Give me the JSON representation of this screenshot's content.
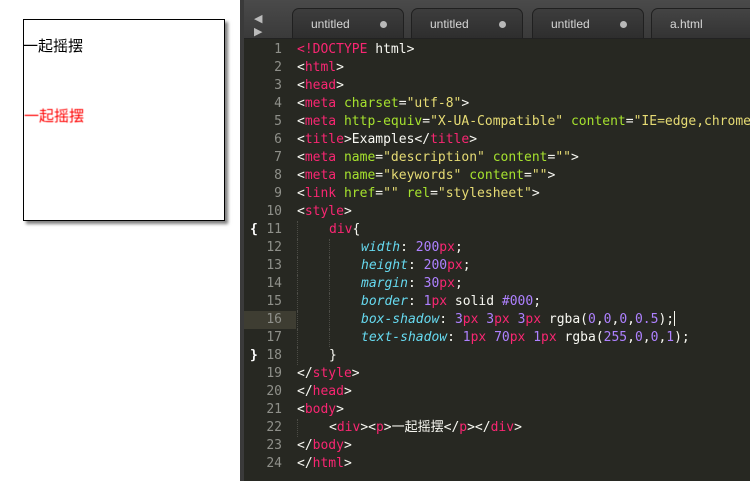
{
  "preview": {
    "text": "一起摇摆"
  },
  "editor": {
    "nav_arrows": "◀ ▶",
    "tabs": [
      {
        "label": "untitled"
      },
      {
        "label": "untitled"
      },
      {
        "label": "untitled"
      },
      {
        "label": "a.html"
      }
    ],
    "lines": [
      {
        "n": "1",
        "tokens": [
          [
            "t-tag",
            "<!DOCTYPE"
          ],
          [
            "t-plain",
            " html>"
          ]
        ]
      },
      {
        "n": "2",
        "tokens": [
          [
            "t-plain",
            "<"
          ],
          [
            "t-tag",
            "html"
          ],
          [
            "t-plain",
            ">"
          ]
        ]
      },
      {
        "n": "3",
        "tokens": [
          [
            "t-plain",
            "<"
          ],
          [
            "t-tag",
            "head"
          ],
          [
            "t-plain",
            ">"
          ]
        ]
      },
      {
        "n": "4",
        "tokens": [
          [
            "t-plain",
            "<"
          ],
          [
            "t-tag",
            "meta"
          ],
          [
            "t-plain",
            " "
          ],
          [
            "t-attr",
            "charset"
          ],
          [
            "t-plain",
            "="
          ],
          [
            "t-str",
            "\"utf-8\""
          ],
          [
            "t-plain",
            ">"
          ]
        ]
      },
      {
        "n": "5",
        "tokens": [
          [
            "t-plain",
            "<"
          ],
          [
            "t-tag",
            "meta"
          ],
          [
            "t-plain",
            " "
          ],
          [
            "t-attr",
            "http-equiv"
          ],
          [
            "t-plain",
            "="
          ],
          [
            "t-str",
            "\"X-UA-Compatible\""
          ],
          [
            "t-plain",
            " "
          ],
          [
            "t-attr",
            "content"
          ],
          [
            "t-plain",
            "="
          ],
          [
            "t-str",
            "\"IE=edge,chrome"
          ]
        ]
      },
      {
        "n": "6",
        "tokens": [
          [
            "t-plain",
            "<"
          ],
          [
            "t-tag",
            "title"
          ],
          [
            "t-plain",
            ">Examples</"
          ],
          [
            "t-tag",
            "title"
          ],
          [
            "t-plain",
            ">"
          ]
        ]
      },
      {
        "n": "7",
        "tokens": [
          [
            "t-plain",
            "<"
          ],
          [
            "t-tag",
            "meta"
          ],
          [
            "t-plain",
            " "
          ],
          [
            "t-attr",
            "name"
          ],
          [
            "t-plain",
            "="
          ],
          [
            "t-str",
            "\"description\""
          ],
          [
            "t-plain",
            " "
          ],
          [
            "t-attr",
            "content"
          ],
          [
            "t-plain",
            "="
          ],
          [
            "t-str",
            "\"\""
          ],
          [
            "t-plain",
            ">"
          ]
        ]
      },
      {
        "n": "8",
        "tokens": [
          [
            "t-plain",
            "<"
          ],
          [
            "t-tag",
            "meta"
          ],
          [
            "t-plain",
            " "
          ],
          [
            "t-attr",
            "name"
          ],
          [
            "t-plain",
            "="
          ],
          [
            "t-str",
            "\"keywords\""
          ],
          [
            "t-plain",
            " "
          ],
          [
            "t-attr",
            "content"
          ],
          [
            "t-plain",
            "="
          ],
          [
            "t-str",
            "\"\""
          ],
          [
            "t-plain",
            ">"
          ]
        ]
      },
      {
        "n": "9",
        "tokens": [
          [
            "t-plain",
            "<"
          ],
          [
            "t-tag",
            "link"
          ],
          [
            "t-plain",
            " "
          ],
          [
            "t-attr",
            "href"
          ],
          [
            "t-plain",
            "="
          ],
          [
            "t-str",
            "\"\""
          ],
          [
            "t-plain",
            " "
          ],
          [
            "t-attr",
            "rel"
          ],
          [
            "t-plain",
            "="
          ],
          [
            "t-str",
            "\"stylesheet\""
          ],
          [
            "t-plain",
            ">"
          ]
        ]
      },
      {
        "n": "10",
        "tokens": [
          [
            "t-plain",
            "<"
          ],
          [
            "t-tag",
            "style"
          ],
          [
            "t-plain",
            ">"
          ]
        ]
      },
      {
        "n": "11",
        "fold": "{",
        "indent": 1,
        "tokens": [
          [
            "t-sel",
            "div"
          ],
          [
            "t-plain",
            "{"
          ]
        ]
      },
      {
        "n": "12",
        "indent": 2,
        "tokens": [
          [
            "t-prop",
            "width"
          ],
          [
            "t-plain",
            ": "
          ],
          [
            "t-num",
            "200"
          ],
          [
            "t-tag",
            "px"
          ],
          [
            "t-plain",
            ";"
          ]
        ]
      },
      {
        "n": "13",
        "indent": 2,
        "tokens": [
          [
            "t-prop",
            "height"
          ],
          [
            "t-plain",
            ": "
          ],
          [
            "t-num",
            "200"
          ],
          [
            "t-tag",
            "px"
          ],
          [
            "t-plain",
            ";"
          ]
        ]
      },
      {
        "n": "14",
        "indent": 2,
        "tokens": [
          [
            "t-prop",
            "margin"
          ],
          [
            "t-plain",
            ": "
          ],
          [
            "t-num",
            "30"
          ],
          [
            "t-tag",
            "px"
          ],
          [
            "t-plain",
            ";"
          ]
        ]
      },
      {
        "n": "15",
        "indent": 2,
        "tokens": [
          [
            "t-prop",
            "border"
          ],
          [
            "t-plain",
            ": "
          ],
          [
            "t-num",
            "1"
          ],
          [
            "t-tag",
            "px"
          ],
          [
            "t-plain",
            " solid "
          ],
          [
            "t-num",
            "#000"
          ],
          [
            "t-plain",
            ";"
          ]
        ]
      },
      {
        "n": "16",
        "indent": 2,
        "hl": true,
        "cursor": true,
        "tokens": [
          [
            "t-prop",
            "box-shadow"
          ],
          [
            "t-plain",
            ": "
          ],
          [
            "t-num",
            "3"
          ],
          [
            "t-tag",
            "px"
          ],
          [
            "t-plain",
            " "
          ],
          [
            "t-num",
            "3"
          ],
          [
            "t-tag",
            "px"
          ],
          [
            "t-plain",
            " "
          ],
          [
            "t-num",
            "3"
          ],
          [
            "t-tag",
            "px"
          ],
          [
            "t-plain",
            " rgba("
          ],
          [
            "t-num",
            "0"
          ],
          [
            "t-plain",
            ","
          ],
          [
            "t-num",
            "0"
          ],
          [
            "t-plain",
            ","
          ],
          [
            "t-num",
            "0"
          ],
          [
            "t-plain",
            ","
          ],
          [
            "t-num",
            "0.5"
          ],
          [
            "t-plain",
            ");"
          ]
        ]
      },
      {
        "n": "17",
        "indent": 2,
        "tokens": [
          [
            "t-prop",
            "text-shadow"
          ],
          [
            "t-plain",
            ": "
          ],
          [
            "t-num",
            "1"
          ],
          [
            "t-tag",
            "px"
          ],
          [
            "t-plain",
            " "
          ],
          [
            "t-num",
            "70"
          ],
          [
            "t-tag",
            "px"
          ],
          [
            "t-plain",
            " "
          ],
          [
            "t-num",
            "1"
          ],
          [
            "t-tag",
            "px"
          ],
          [
            "t-plain",
            " rgba("
          ],
          [
            "t-num",
            "255"
          ],
          [
            "t-plain",
            ","
          ],
          [
            "t-num",
            "0"
          ],
          [
            "t-plain",
            ","
          ],
          [
            "t-num",
            "0"
          ],
          [
            "t-plain",
            ","
          ],
          [
            "t-num",
            "1"
          ],
          [
            "t-plain",
            ");"
          ]
        ]
      },
      {
        "n": "18",
        "fold": "}",
        "indent": 1,
        "tokens": [
          [
            "t-plain",
            "}"
          ]
        ]
      },
      {
        "n": "19",
        "tokens": [
          [
            "t-plain",
            "</"
          ],
          [
            "t-tag",
            "style"
          ],
          [
            "t-plain",
            ">"
          ]
        ]
      },
      {
        "n": "20",
        "tokens": [
          [
            "t-plain",
            "</"
          ],
          [
            "t-tag",
            "head"
          ],
          [
            "t-plain",
            ">"
          ]
        ]
      },
      {
        "n": "21",
        "tokens": [
          [
            "t-plain",
            "<"
          ],
          [
            "t-tag",
            "body"
          ],
          [
            "t-plain",
            ">"
          ]
        ]
      },
      {
        "n": "22",
        "indent": 1,
        "tokens": [
          [
            "t-plain",
            "<"
          ],
          [
            "t-tag",
            "div"
          ],
          [
            "t-plain",
            "><"
          ],
          [
            "t-tag",
            "p"
          ],
          [
            "t-plain",
            ">一起摇摆</"
          ],
          [
            "t-tag",
            "p"
          ],
          [
            "t-plain",
            "></"
          ],
          [
            "t-tag",
            "div"
          ],
          [
            "t-plain",
            ">"
          ]
        ]
      },
      {
        "n": "23",
        "tokens": [
          [
            "t-plain",
            "</"
          ],
          [
            "t-tag",
            "body"
          ],
          [
            "t-plain",
            ">"
          ]
        ]
      },
      {
        "n": "24",
        "tokens": [
          [
            "t-plain",
            "</"
          ],
          [
            "t-tag",
            "html"
          ],
          [
            "t-plain",
            ">"
          ]
        ]
      }
    ]
  }
}
